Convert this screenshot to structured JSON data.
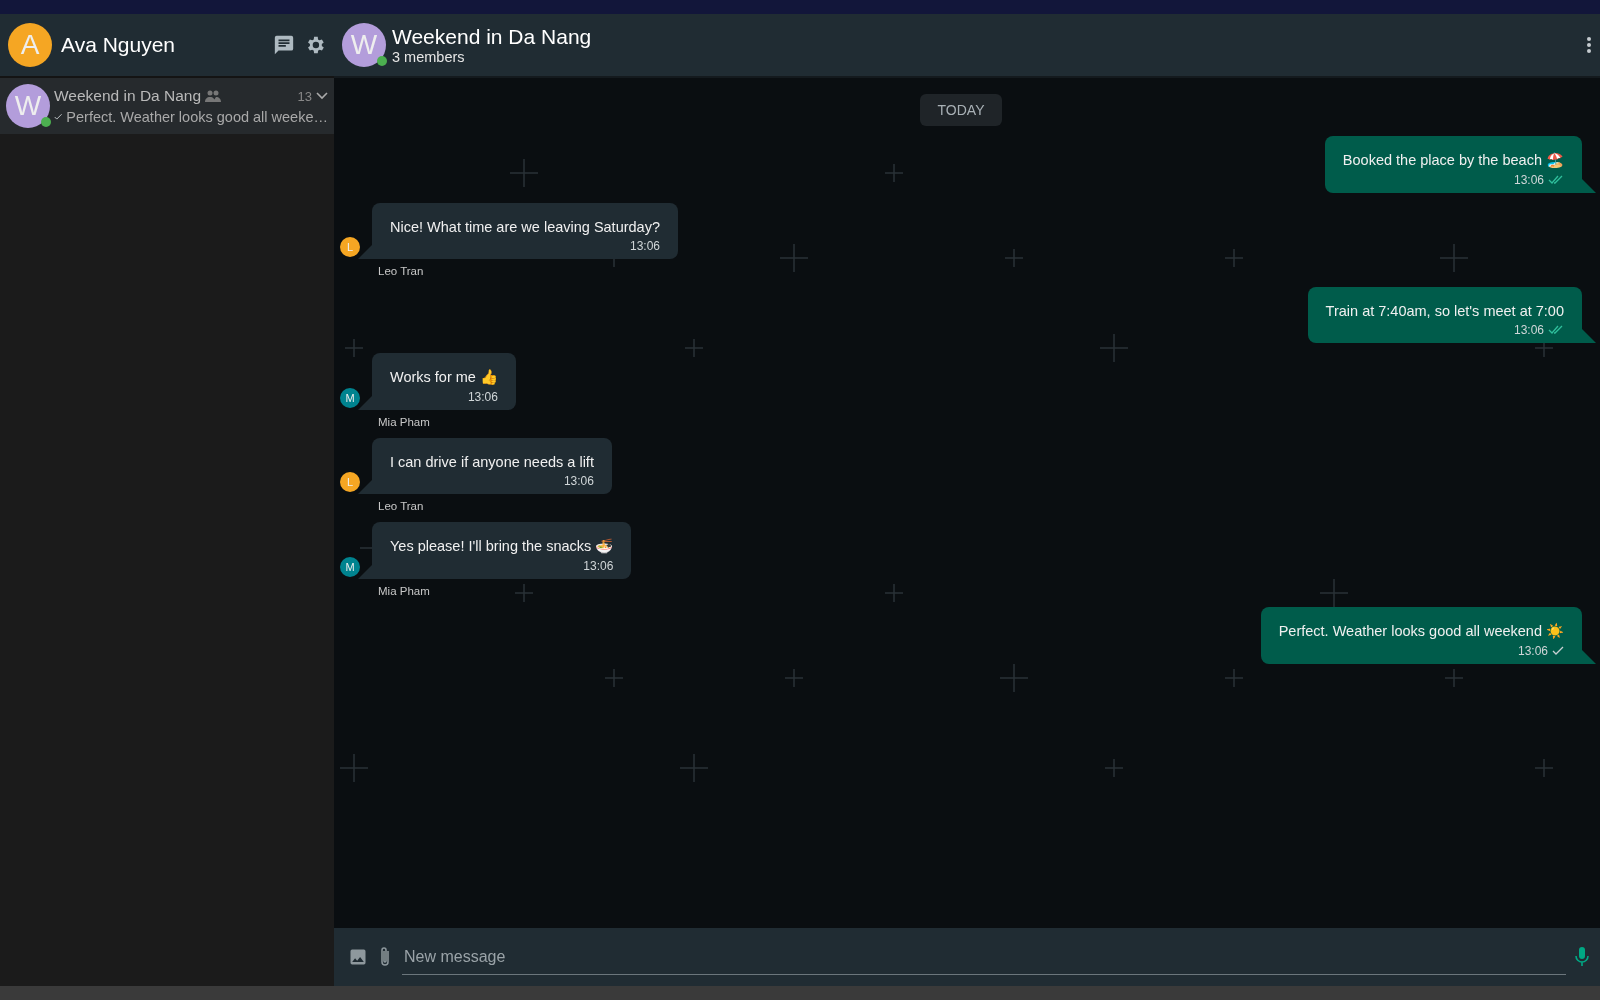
{
  "profile": {
    "initial": "A",
    "name": "Ava Nguyen"
  },
  "chats": [
    {
      "initial": "W",
      "name": "Weekend in Da Nang",
      "time": "13",
      "preview": "Perfect. Weather looks good all weeke…",
      "read": false,
      "online": true,
      "selected": true
    }
  ],
  "conversation": {
    "initial": "W",
    "title": "Weekend in Da Nang",
    "subtitle": "3 members",
    "online": true
  },
  "day_label": "TODAY",
  "messages": [
    {
      "kind": "outgoing",
      "text": "Booked the place by the beach 🏖️",
      "time": "13:06",
      "read": true
    },
    {
      "kind": "incoming",
      "text": "Nice! What time are we leaving Saturday?",
      "time": "13:06",
      "sender": "Leo Tran",
      "initial": "L",
      "color": "#f5a623"
    },
    {
      "kind": "outgoing",
      "text": "Train at 7:40am, so let's meet at 7:00",
      "time": "13:06",
      "read": true
    },
    {
      "kind": "incoming",
      "text": "Works for me 👍",
      "time": "13:06",
      "sender": "Mia Pham",
      "initial": "M",
      "color": "#00838f"
    },
    {
      "kind": "incoming",
      "text": "I can drive if anyone needs a lift",
      "time": "13:06",
      "sender": "Leo Tran",
      "initial": "L",
      "color": "#f5a623"
    },
    {
      "kind": "incoming",
      "text": "Yes please! I'll bring the snacks 🍜",
      "time": "13:06",
      "sender": "Mia Pham",
      "initial": "M",
      "color": "#00838f"
    },
    {
      "kind": "outgoing",
      "text": "Perfect. Weather looks good all weekend ☀️",
      "time": "13:06",
      "read": false
    }
  ],
  "composer": {
    "placeholder": "New message"
  }
}
